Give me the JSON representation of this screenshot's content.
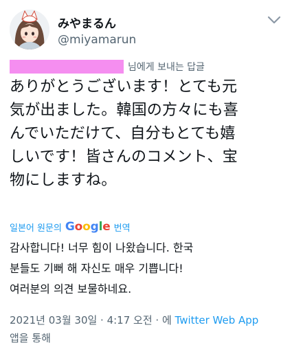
{
  "user": {
    "display_name": "みやまるん",
    "handle": "@miyamarun"
  },
  "header": {
    "more_icon": "more-vertical-icon"
  },
  "reply": {
    "text": "님에게 보내는 답글"
  },
  "tweet": {
    "lines": [
      "ありがとうございます！とても元",
      "気が出ました。韓国の方々にも喜",
      "んでいただけて、自分もとても嬉",
      "しいです！皆さんのコメント、宝",
      "物にしますね。"
    ]
  },
  "translation": {
    "prefix": "일본어 원문의",
    "brand_letters": [
      "G",
      "o",
      "o",
      "g",
      "l",
      "e"
    ],
    "brand_colors": [
      "#4285F4",
      "#EA4335",
      "#FBBC05",
      "#4285F4",
      "#34A853",
      "#EA4335"
    ],
    "suffix": "번역",
    "lines": [
      "감사합니다! 너무 힘이 나왔습니다. 한국",
      "분들도 기뻐 해 자신도 매우 기쁩니다!",
      "여러분의 의견 보물하네요."
    ]
  },
  "meta": {
    "timestamp": "2021년 03월 30일 · 4:17 오전 · 에 ",
    "source": "Twitter Web App",
    "suffix": "앱을 통해"
  },
  "colors": {
    "accent": "#1d9bf0",
    "secondary_text": "#536471",
    "redaction": "#f58ef0"
  }
}
